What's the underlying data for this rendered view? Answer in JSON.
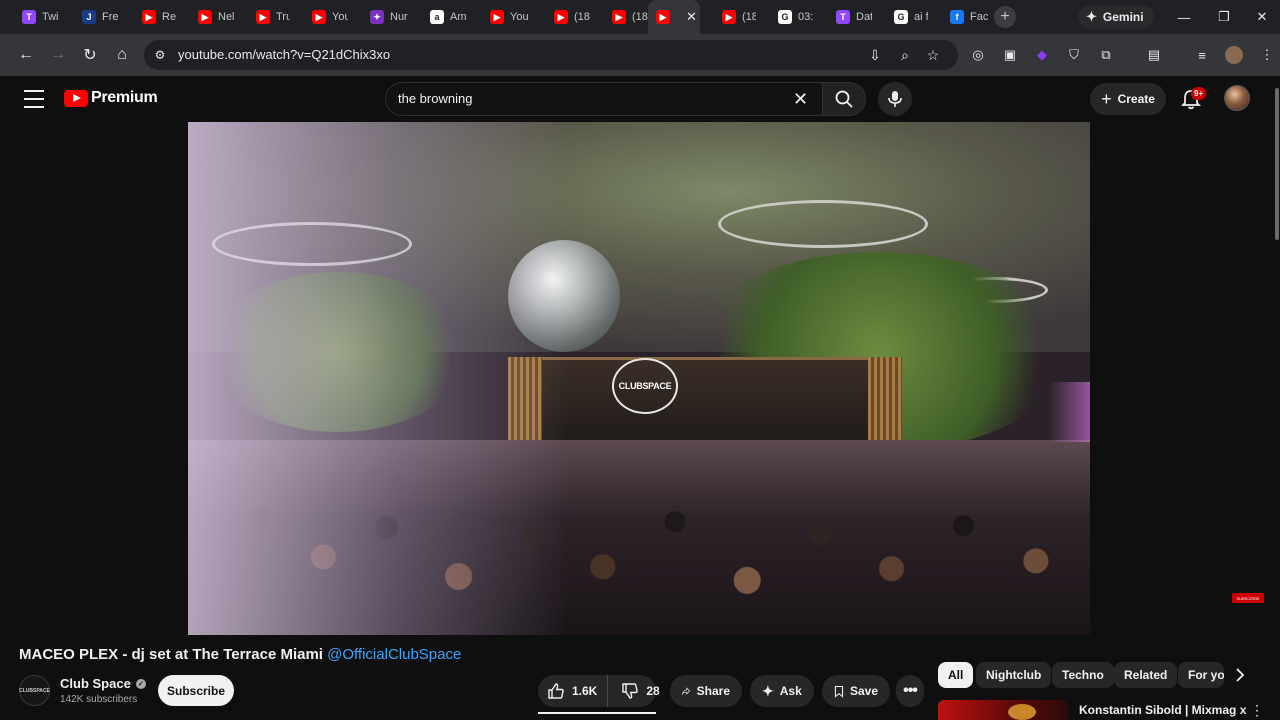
{
  "browser": {
    "tabs": [
      {
        "label": "Twi",
        "icon": "twitch-icon",
        "color": "#9146ff",
        "glyph": "T"
      },
      {
        "label": "Fre",
        "icon": "j-icon",
        "color": "#1a3a8a",
        "glyph": "J"
      },
      {
        "label": "Rea",
        "icon": "youtube-icon",
        "color": "#ff0000",
        "glyph": "▶"
      },
      {
        "label": "Nel",
        "icon": "youtube-icon",
        "color": "#ff0000",
        "glyph": "▶"
      },
      {
        "label": "Tru",
        "icon": "youtube-icon",
        "color": "#ff0000",
        "glyph": "▶"
      },
      {
        "label": "You",
        "icon": "youtube-icon",
        "color": "#ff0000",
        "glyph": "▶"
      },
      {
        "label": "Nur",
        "icon": "app-icon",
        "color": "#7b2fbe",
        "glyph": "✦"
      },
      {
        "label": "Am",
        "icon": "amazon-icon",
        "color": "#ffffff",
        "glyph": "a"
      },
      {
        "label": "You",
        "icon": "youtube-icon",
        "color": "#ff0000",
        "glyph": "▶"
      },
      {
        "label": "(18",
        "icon": "youtube-icon",
        "color": "#ff0000",
        "glyph": "▶"
      },
      {
        "label": "(18",
        "icon": "youtube-icon",
        "color": "#ff0000",
        "glyph": "▶"
      },
      {
        "label": "",
        "icon": "youtube-icon",
        "color": "#ff0000",
        "glyph": "▶",
        "active": true
      },
      {
        "label": "(18",
        "icon": "youtube-icon",
        "color": "#ff0000",
        "glyph": "▶"
      },
      {
        "label": "03:",
        "icon": "google-icon",
        "color": "#ffffff",
        "glyph": "G"
      },
      {
        "label": "Dat",
        "icon": "twitch-icon",
        "color": "#9146ff",
        "glyph": "T"
      },
      {
        "label": "ai f",
        "icon": "google-icon",
        "color": "#ffffff",
        "glyph": "G"
      },
      {
        "label": "Fac",
        "icon": "facebook-icon",
        "color": "#1877f2",
        "glyph": "f"
      }
    ],
    "gemini_label": "Gemini",
    "url": "youtube.com/watch?v=Q21dChix3xo"
  },
  "yt": {
    "logo_text": "Premium",
    "search_value": "the browning",
    "create_label": "Create",
    "notification_badge": "9+"
  },
  "video": {
    "club_logo_text": "CLUBSPACE",
    "watermark_text": "SUBSCRIBE",
    "title": "MACEO PLEX - dj set at The Terrace Miami ",
    "title_mention": "@OfficialClubSpace",
    "channel_name": "Club Space",
    "channel_avatar_text": "CLUBSPACE",
    "subscribers": "142K subscribers",
    "subscribe_label": "Subscribe",
    "likes": "1.6K",
    "dislikes": "28",
    "share_label": "Share",
    "ask_label": "Ask",
    "save_label": "Save"
  },
  "chips": [
    {
      "label": "All",
      "selected": true
    },
    {
      "label": "Nightclub",
      "selected": false
    },
    {
      "label": "Techno",
      "selected": false
    },
    {
      "label": "Related",
      "selected": false
    },
    {
      "label": "For yo",
      "selected": false
    }
  ],
  "recommendation": {
    "title": "Konstantin Sibold | Mixmag x"
  }
}
